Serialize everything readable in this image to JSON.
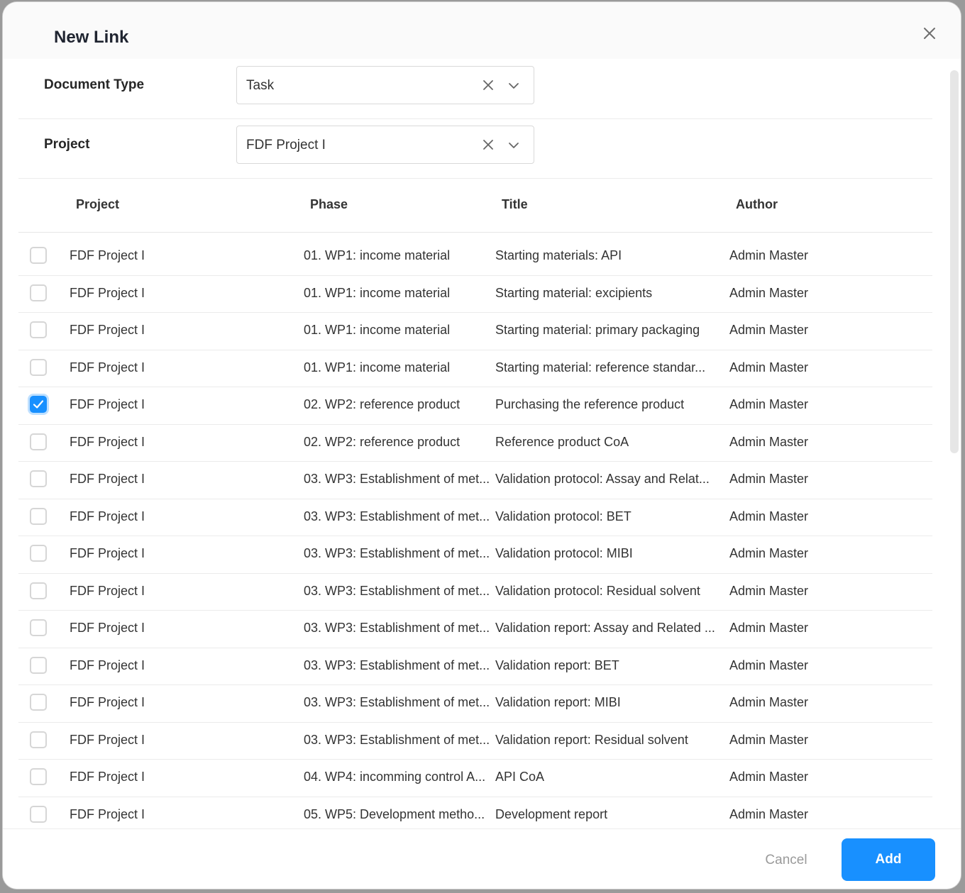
{
  "dialog": {
    "title": "New Link",
    "cancel_label": "Cancel",
    "add_label": "Add"
  },
  "form": {
    "document_type": {
      "label": "Document Type",
      "value": "Task"
    },
    "project": {
      "label": "Project",
      "value": "FDF Project I"
    }
  },
  "table": {
    "columns": [
      "Project",
      "Phase",
      "Title",
      "Author"
    ],
    "rows": [
      {
        "checked": false,
        "project": "FDF Project I",
        "phase": "01. WP1: income material",
        "title": "Starting materials: API",
        "author": "Admin Master"
      },
      {
        "checked": false,
        "project": "FDF Project I",
        "phase": "01. WP1: income material",
        "title": "Starting material: excipients",
        "author": "Admin Master"
      },
      {
        "checked": false,
        "project": "FDF Project I",
        "phase": "01. WP1: income material",
        "title": "Starting material: primary packaging",
        "author": "Admin Master"
      },
      {
        "checked": false,
        "project": "FDF Project I",
        "phase": "01. WP1: income material",
        "title": "Starting material: reference standar...",
        "author": "Admin Master"
      },
      {
        "checked": true,
        "project": "FDF Project I",
        "phase": "02. WP2: reference product",
        "title": "Purchasing the reference product",
        "author": "Admin Master"
      },
      {
        "checked": false,
        "project": "FDF Project I",
        "phase": "02. WP2: reference product",
        "title": "Reference product CoA",
        "author": "Admin Master"
      },
      {
        "checked": false,
        "project": "FDF Project I",
        "phase": "03. WP3: Establishment of met...",
        "title": "Validation protocol: Assay and Relat...",
        "author": "Admin Master"
      },
      {
        "checked": false,
        "project": "FDF Project I",
        "phase": "03. WP3: Establishment of met...",
        "title": "Validation protocol: BET",
        "author": "Admin Master"
      },
      {
        "checked": false,
        "project": "FDF Project I",
        "phase": "03. WP3: Establishment of met...",
        "title": "Validation protocol: MIBI",
        "author": "Admin Master"
      },
      {
        "checked": false,
        "project": "FDF Project I",
        "phase": "03. WP3: Establishment of met...",
        "title": "Validation protocol: Residual solvent",
        "author": "Admin Master"
      },
      {
        "checked": false,
        "project": "FDF Project I",
        "phase": "03. WP3: Establishment of met...",
        "title": "Validation report: Assay and Related ...",
        "author": "Admin Master"
      },
      {
        "checked": false,
        "project": "FDF Project I",
        "phase": "03. WP3: Establishment of met...",
        "title": "Validation report: BET",
        "author": "Admin Master"
      },
      {
        "checked": false,
        "project": "FDF Project I",
        "phase": "03. WP3: Establishment of met...",
        "title": "Validation report: MIBI",
        "author": "Admin Master"
      },
      {
        "checked": false,
        "project": "FDF Project I",
        "phase": "03. WP3: Establishment of met...",
        "title": "Validation report: Residual solvent",
        "author": "Admin Master"
      },
      {
        "checked": false,
        "project": "FDF Project I",
        "phase": "04. WP4: incomming control A...",
        "title": "API CoA",
        "author": "Admin Master"
      },
      {
        "checked": false,
        "project": "FDF Project I",
        "phase": "05. WP5: Development metho...",
        "title": "Development report",
        "author": "Admin Master"
      }
    ]
  },
  "icons": {
    "close": "close-icon",
    "clear": "clear-icon",
    "dropdown": "chevron-down-icon",
    "check": "check-icon"
  },
  "colors": {
    "accent": "#1890ff"
  }
}
